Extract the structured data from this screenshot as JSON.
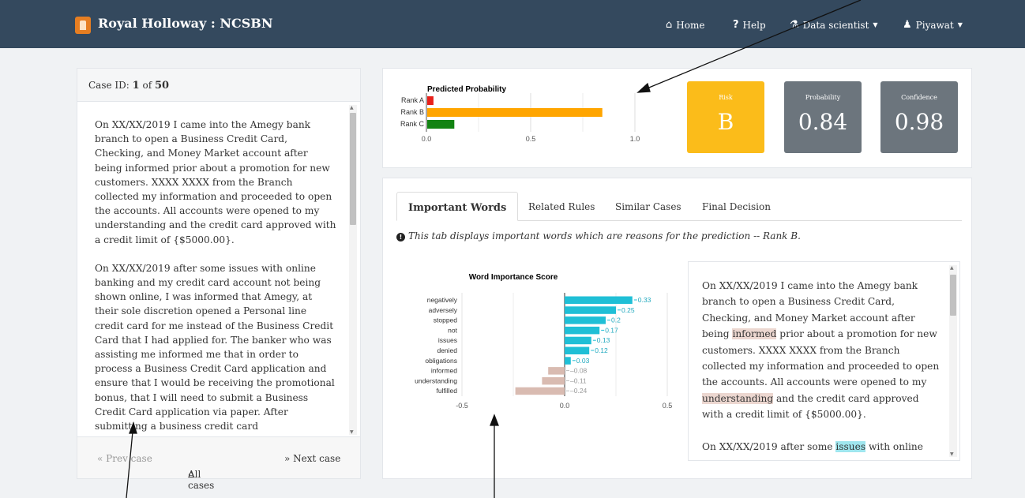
{
  "navbar": {
    "brand": "Royal Holloway : NCSBN",
    "items": [
      {
        "icon": "home-icon",
        "glyph": "⌂",
        "label": "Home"
      },
      {
        "icon": "help-icon",
        "glyph": "?",
        "label": "Help"
      },
      {
        "icon": "data-scientist-icon",
        "glyph": "⚗",
        "label": "Data scientist"
      },
      {
        "icon": "user-icon",
        "glyph": "♟",
        "label": "Piyawat"
      }
    ]
  },
  "case": {
    "prefix": "Case ID: ",
    "id": "1",
    "of": " of ",
    "total": "50",
    "paragraphs": [
      "On XX/XX/2019 I came into the Amegy bank branch to open a Business Credit Card, Checking, and Money Market account after being informed prior about a promotion for new customers. XXXX XXXX from the Branch collected my information and proceeded to open the accounts. All accounts were opened to my understanding and the credit card approved with a credit limit of {$5000.00}.",
      "On XX/XX/2019 after some issues with online banking and my credit card account not being shown online, I was informed that Amegy, at their sole discretion opened a Personal line credit card for me instead of the Business Credit Card that I had applied for. The banker who was assisting me informed me that in order to process a Business Credit Card application and ensure that I would be receiving the promotional bonus, that I will need to submit a Business Credit Card application via paper. After submitting a business credit card"
    ],
    "prev": "« Prev case",
    "all": "All cases",
    "next": "» Next case"
  },
  "kpis": {
    "risk": {
      "label": "Risk",
      "value": "B",
      "color": "#fbbc1a"
    },
    "probability": {
      "label": "Probability",
      "value": "0.84",
      "color": "#6c757d"
    },
    "confidence": {
      "label": "Confidence",
      "value": "0.98",
      "color": "#6c757d"
    }
  },
  "tabs": [
    "Important Words",
    "Related Rules",
    "Similar Cases",
    "Final Decision"
  ],
  "info_text": "This tab displays important words which are reasons for the prediction -- Rank B.",
  "highlight_text": {
    "p1_before": "On XX/XX/2019 I came into the Amegy bank branch to open a Business Credit Card, Checking, and Money Market account after being ",
    "p1_w1": "informed",
    "p1_mid": " prior about a promotion for new customers. XXXX XXXX from the Branch collected my information and proceeded to open the accounts. All accounts were opened to my ",
    "p1_w2": "understanding",
    "p1_after": " and the credit card approved with a credit limit of {$5000.00}.",
    "p2_before": "On XX/XX/2019 after some ",
    "p2_w1": "issues",
    "p2_after": " with online"
  },
  "chart_data": [
    {
      "type": "bar",
      "orientation": "horizontal",
      "title": "Predicted Probability",
      "categories": [
        "Rank A",
        "Rank B",
        "Rank C"
      ],
      "values": [
        0.03,
        0.84,
        0.13
      ],
      "colors": [
        "#e8211b",
        "#ffa500",
        "#128312"
      ],
      "xlim": [
        0,
        1
      ],
      "xticks": [
        "0.0",
        "0.5",
        "1.0"
      ],
      "grid": true
    },
    {
      "type": "bar",
      "orientation": "horizontal",
      "title": "Word Importance Score",
      "categories": [
        "negatively",
        "adversely",
        "stopped",
        "not",
        "issues",
        "denied",
        "obligations",
        "informed",
        "understanding",
        "fulfilled"
      ],
      "values": [
        0.33,
        0.25,
        0.2,
        0.17,
        0.13,
        0.12,
        0.03,
        -0.08,
        -0.11,
        -0.24
      ],
      "labels": [
        "0.33",
        "0.25",
        "0.2",
        "0.17",
        "0.13",
        "0.12",
        "0.03",
        "-0.08",
        "-0.11",
        "-0.24"
      ],
      "positive_color": "#1fbfd6",
      "negative_color": "#d9bbb1",
      "xlim": [
        -0.5,
        0.5
      ],
      "xticks": [
        "-0.5",
        "0.0",
        "0.5"
      ],
      "grid": true
    }
  ]
}
